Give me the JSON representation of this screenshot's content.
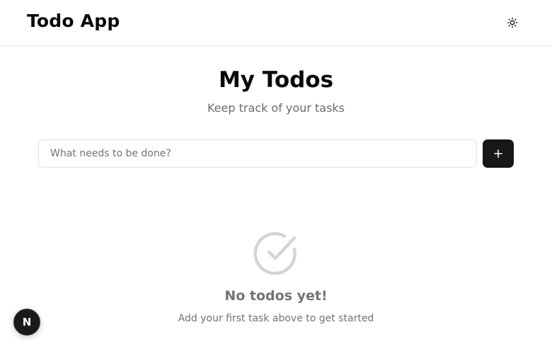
{
  "header": {
    "app_title": "Todo App",
    "theme_toggle_icon": "sun-icon"
  },
  "main": {
    "title": "My Todos",
    "subtitle": "Keep track of your tasks",
    "input": {
      "placeholder": "What needs to be done?",
      "value": ""
    },
    "add_button_icon": "plus-icon",
    "add_button_label": "+",
    "empty_state": {
      "icon": "check-circle-icon",
      "title": "No todos yet!",
      "message": "Add your first task above to get started"
    }
  },
  "dev_badge": {
    "label": "N",
    "icon": "nextjs-logo-icon"
  },
  "colors": {
    "accent": "#171717",
    "muted_text": "#737373",
    "border": "#e5e5e5",
    "icon_gray": "#d4d4d4"
  }
}
